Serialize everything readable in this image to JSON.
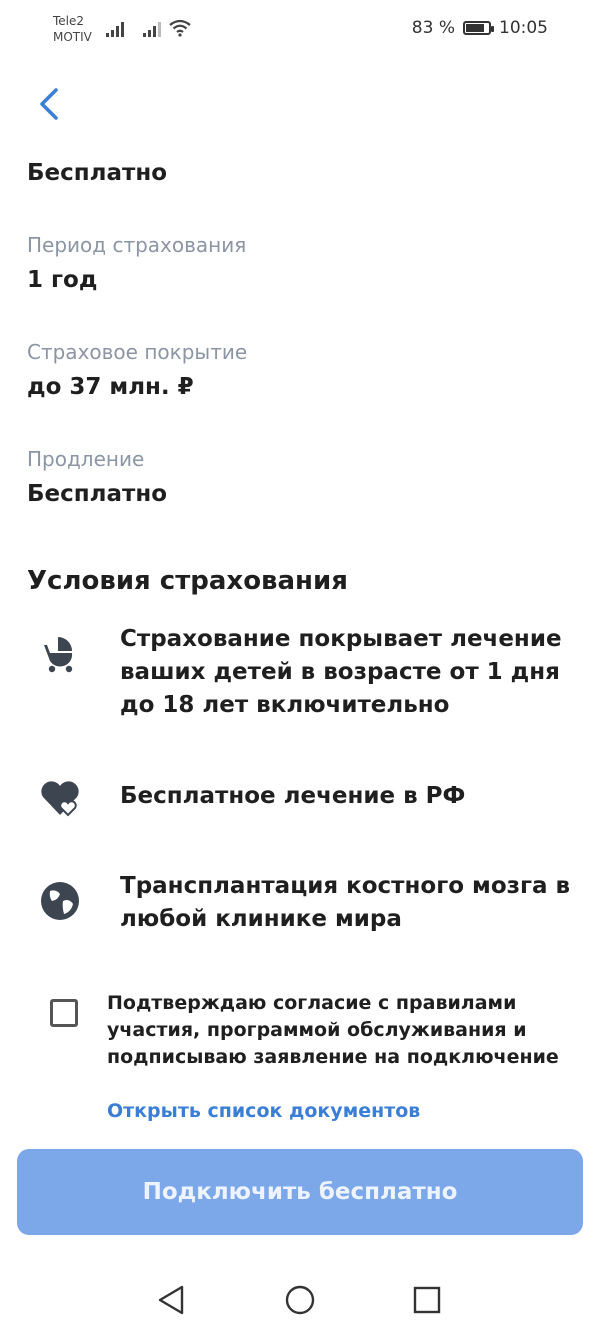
{
  "status_bar": {
    "carrier1": "Tele2",
    "carrier2": "MOTIV",
    "battery_text": "83 %",
    "battery_level": 0.83,
    "time": "10:05"
  },
  "header": {
    "price": "Бесплатно"
  },
  "details": [
    {
      "label": "Период страхования",
      "value": "1 год"
    },
    {
      "label": "Страховое покрытие",
      "value": "до 37 млн. ₽"
    },
    {
      "label": "Продление",
      "value": "Бесплатно"
    }
  ],
  "conditions": {
    "title": "Условия страхования",
    "items": [
      {
        "icon": "stroller-icon",
        "text": "Страхование покрывает лечение ваших детей в возрасте от 1 дня до 18 лет включительно"
      },
      {
        "icon": "heart-icon",
        "text": "Бесплатное лечение в РФ"
      },
      {
        "icon": "globe-icon",
        "text": "Трансплантация костного мозга в любой клинике мира"
      }
    ]
  },
  "consent": {
    "checked": false,
    "text": "Подтверждаю согласие с правилами участия, программой обслуживания и подписываю заявление на подключение",
    "docs_link": "Открыть список документов"
  },
  "cta": {
    "label": "Подключить бесплатно"
  },
  "colors": {
    "accent": "#3a7fd5",
    "cta_bg": "#7ca8ea",
    "label_gray": "#8b95a3",
    "icon_dark": "#3d4550"
  }
}
